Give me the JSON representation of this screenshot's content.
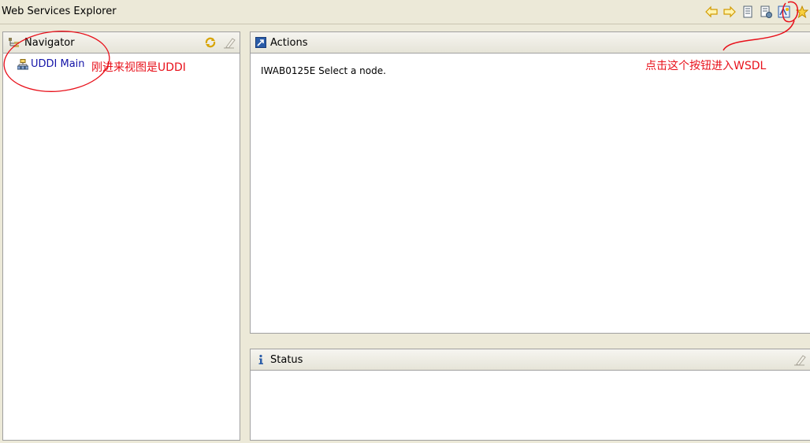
{
  "window": {
    "title": "Web Services Explorer"
  },
  "toolbar": {
    "buttons": [
      {
        "name": "back-button",
        "icon": "arrow-left-icon"
      },
      {
        "name": "forward-button",
        "icon": "arrow-right-icon"
      },
      {
        "name": "uddi-page-button",
        "icon": "document-icon"
      },
      {
        "name": "wsil-page-button",
        "icon": "document-globe-icon"
      },
      {
        "name": "wsdl-page-button",
        "icon": "wsdl-icon"
      },
      {
        "name": "favorites-button",
        "icon": "star-icon"
      }
    ]
  },
  "navigator": {
    "title": "Navigator",
    "tree": [
      {
        "label": "UDDI Main",
        "icon": "tree-node-icon"
      }
    ]
  },
  "actions": {
    "title": "Actions",
    "message": "IWAB0125E Select a node."
  },
  "status": {
    "title": "Status"
  },
  "annotations": {
    "navigator_note": "刚进来视图是UDDI",
    "toolbar_note": "点击这个按钮进入WSDL",
    "color": "#e8101a"
  },
  "colors": {
    "background": "#ece9d8",
    "link": "#1414a8",
    "icon_yellow": "#f0b800",
    "icon_blue": "#2a5ca8"
  }
}
